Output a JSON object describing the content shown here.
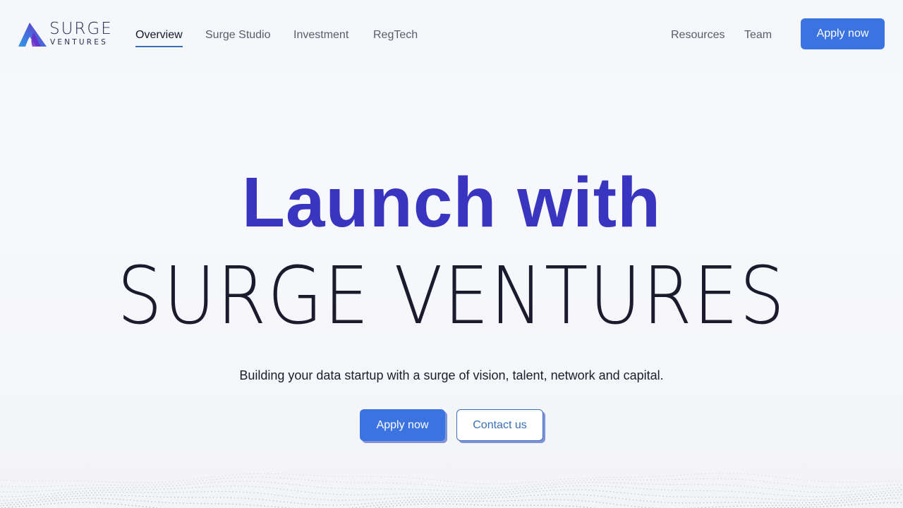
{
  "brand": {
    "line1": "SURGE",
    "line2": "VENTURES",
    "colors": {
      "primary": "#3a35c0",
      "accent": "#3b73e0",
      "gradient_start": "#2f9be8",
      "gradient_end": "#6a2cc9"
    }
  },
  "nav": {
    "left": [
      {
        "label": "Overview",
        "active": true
      },
      {
        "label": "Surge Studio"
      },
      {
        "label": "Investment"
      },
      {
        "label": "RegTech"
      }
    ],
    "right": [
      {
        "label": "Resources"
      },
      {
        "label": "Team"
      }
    ],
    "cta": "Apply now"
  },
  "hero": {
    "line1": "Launch with",
    "line2": "SURGE VENTURES",
    "subtitle": "Building your data startup with a surge of vision, talent, network and capital.",
    "primary_cta": "Apply now",
    "secondary_cta": "Contact us"
  },
  "colors": {
    "background": "#f6f7fa",
    "button_blue": "#3b73e0",
    "button_shadow": "#7f93d6",
    "nav_underline": "#3a6fb8"
  }
}
